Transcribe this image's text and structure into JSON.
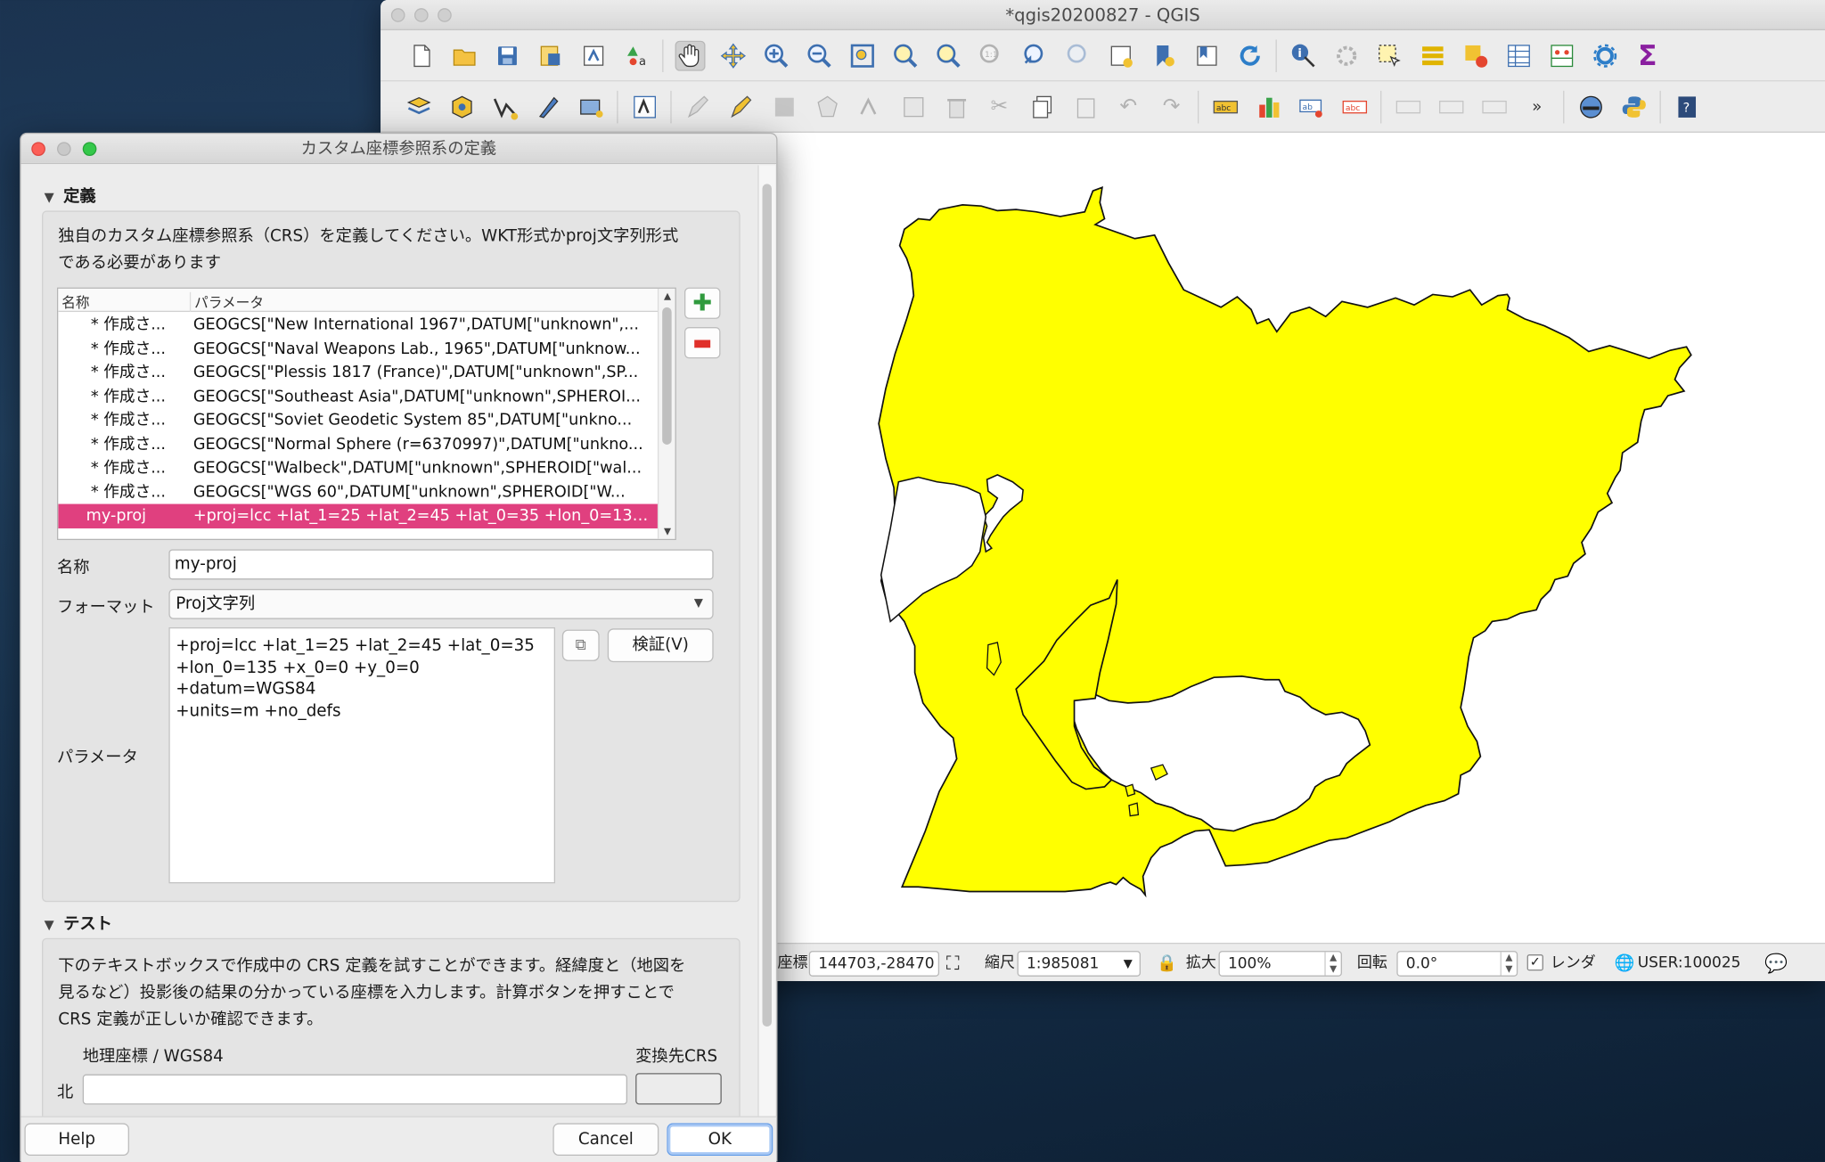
{
  "qgis": {
    "title": "*qgis20200827 - QGIS",
    "toolbar1_icons": [
      "new-project-icon",
      "open-project-icon",
      "save-project-icon",
      "save-as-icon",
      "print-layout-icon",
      "style-manager-icon",
      "pan-hand-icon",
      "pan-to-selection-icon",
      "zoom-in-icon",
      "zoom-out-icon",
      "zoom-full-icon",
      "zoom-selection-icon",
      "zoom-layer-icon",
      "zoom-native-icon",
      "zoom-last-icon",
      "zoom-next-icon",
      "new-map-view-icon",
      "bookmark-icon",
      "show-bookmarks-icon",
      "refresh-icon",
      "identify-icon",
      "run-action-icon",
      "select-features-icon",
      "attribute-table-icon",
      "deselect-icon",
      "open-table-icon",
      "field-calculator-icon",
      "toolbox-icon",
      "statistics-icon"
    ],
    "toolbar2_icons": [
      "data-source-manager-icon",
      "new-geopackage-icon",
      "digitize-icon",
      "new-spatialite-icon",
      "new-virtual-layer-icon",
      "edit-layer-icon",
      "toggle-editing-icon",
      "current-edits-icon",
      "save-edits-icon",
      "add-polygon-icon",
      "vertex-tool-icon",
      "modify-attributes-icon",
      "delete-selected-icon",
      "cut-features-icon",
      "copy-features-icon",
      "paste-features-icon",
      "undo-icon",
      "redo-icon",
      "label-tool-icon",
      "diagram-tool-icon",
      "pin-labels-icon",
      "label-highlight-icon",
      "show-hide-labels-icon",
      "move-label-icon",
      "rotate-label-icon",
      "change-label-icon",
      "globe-plugin-icon",
      "python-icon",
      "help-icon"
    ],
    "status": {
      "coord_label": "座標",
      "coord_value": "144703,-28470",
      "scale_label": "縮尺",
      "scale_value": "1:985081",
      "magnifier_label": "拡大",
      "magnifier_value": "100%",
      "rotation_label": "回転",
      "rotation_value": "0.0°",
      "render_label": "レンダ",
      "crs_value": "USER:100025"
    }
  },
  "dialog": {
    "title": "カスタム座標参照系の定義",
    "definition_section": "定義",
    "definition_desc_line1": "独自のカスタム座標参照系（CRS）を定義してください。WKT形式かproj文字列形式",
    "definition_desc_line2": "である必要があります",
    "table": {
      "col_name": "名称",
      "col_params": "パラメータ",
      "rows": [
        {
          "name": "* 作成さ...",
          "params": "GEOGCS[\"New International 1967\",DATUM[\"unknown\",..."
        },
        {
          "name": "* 作成さ...",
          "params": "GEOGCS[\"Naval Weapons Lab., 1965\",DATUM[\"unknow..."
        },
        {
          "name": "* 作成さ...",
          "params": "GEOGCS[\"Plessis 1817 (France)\",DATUM[\"unknown\",SP..."
        },
        {
          "name": "* 作成さ...",
          "params": "GEOGCS[\"Southeast Asia\",DATUM[\"unknown\",SPHEROI..."
        },
        {
          "name": "* 作成さ...",
          "params": "GEOGCS[\"Soviet Geodetic System 85\",DATUM[\"unkno..."
        },
        {
          "name": "* 作成さ...",
          "params": "GEOGCS[\"Normal Sphere (r=6370997)\",DATUM[\"unkno..."
        },
        {
          "name": "* 作成さ...",
          "params": "GEOGCS[\"Walbeck\",DATUM[\"unknown\",SPHEROID[\"wal..."
        },
        {
          "name": "* 作成さ...",
          "params": "GEOGCS[\"WGS 60\",DATUM[\"unknown\",SPHEROID[\"W..."
        },
        {
          "name": "my-proj",
          "params": "+proj=lcc +lat_1=25 +lat_2=45 +lat_0=35 +lon_0=135 +..."
        }
      ]
    },
    "name_label": "名称",
    "name_value": "my-proj",
    "format_label": "フォーマット",
    "format_value": "Proj文字列",
    "validate_label": "検証(V)",
    "params_label": "パラメータ",
    "params_value": "+proj=lcc +lat_1=25 +lat_2=45 +lat_0=35\n+lon_0=135 +x_0=0 +y_0=0 +datum=WGS84\n+units=m +no_defs",
    "test_section": "テスト",
    "test_desc_line1": "下のテキストボックスで作成中の CRS 定義を試すことができます。経緯度と（地図を",
    "test_desc_line2": "見るなど）投影後の結果の分かっている座標を入力します。計算ボタンを押すことで",
    "test_desc_line3": "CRS 定義が正しいか確認できます。",
    "geo_label": "地理座標 / WGS84",
    "dest_label": "変換先CRS",
    "north_label": "北",
    "north_value": "",
    "help_label": "Help",
    "cancel_label": "Cancel",
    "ok_label": "OK"
  },
  "colors": {
    "polygon_fill": "#ffff00",
    "selection": "#e0407f"
  }
}
